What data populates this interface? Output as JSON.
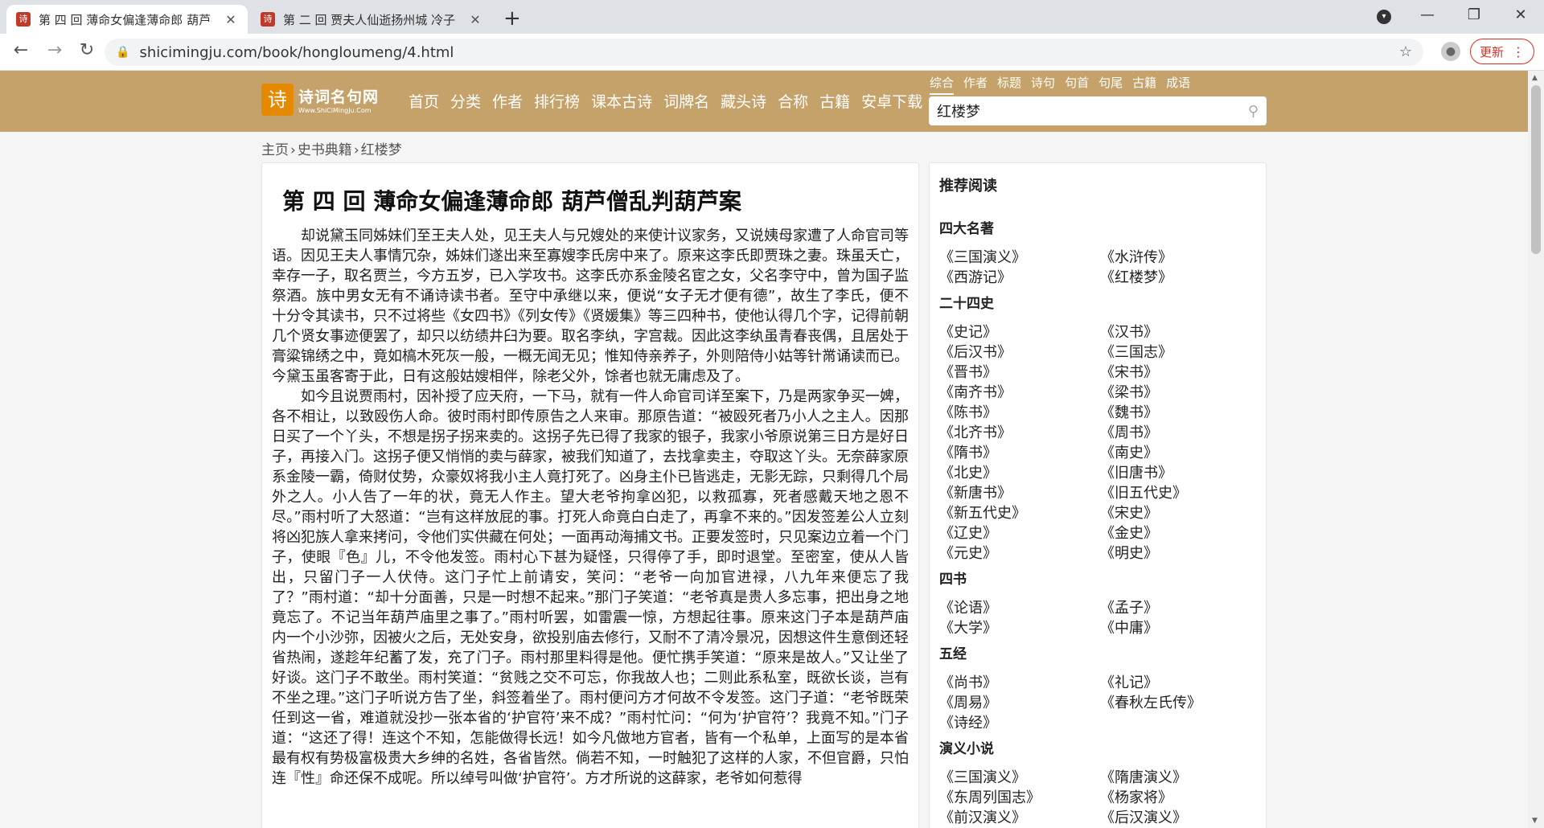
{
  "browser": {
    "tabs": [
      {
        "title": "第 四 回 薄命女偏逢薄命郎 葫芦",
        "favicon": "诗",
        "active": true
      },
      {
        "title": "第 二 回 贾夫人仙逝扬州城 冷子",
        "favicon": "诗",
        "active": false
      }
    ],
    "new_tab": "+",
    "url": "shicimingju.com/book/hongloumeng/4.html",
    "update_label": "更新",
    "icons": {
      "back": "←",
      "forward": "→",
      "reload": "↻",
      "lock": "🔒",
      "star": "☆",
      "close": "✕",
      "minimize": "—",
      "maximize": "❐",
      "menu": "⋮"
    }
  },
  "site": {
    "logo_text": "诗词名句网",
    "logo_sub": "Www.ShiCiMingJu.Com",
    "logo_mark": "诗",
    "nav": [
      "首页",
      "分类",
      "作者",
      "排行榜",
      "课本古诗",
      "词牌名",
      "藏头诗",
      "合称",
      "古籍",
      "安卓下载"
    ],
    "search_tabs": [
      "综合",
      "作者",
      "标题",
      "诗句",
      "句首",
      "句尾",
      "古籍",
      "成语"
    ],
    "search_value": "红楼梦"
  },
  "breadcrumb": [
    "主页",
    "史书典籍",
    "红楼梦"
  ],
  "breadcrumb_sep": "›",
  "chapter": {
    "title": "第 四 回 薄命女偏逢薄命郎 葫芦僧乱判葫芦案",
    "paragraphs": [
      "却说黛玉同姊妹们至王夫人处，见王夫人与兄嫂处的来使计议家务，又说姨母家遭了人命官司等语。因见王夫人事情冗杂，姊妹们遂出来至寡嫂李氏房中来了。原来这李氏即贾珠之妻。珠虽夭亡，幸存一子，取名贾兰，今方五岁，已入学攻书。这李氏亦系金陵名宦之女，父名李守中，曾为国子监祭酒。族中男女无有不诵诗读书者。至守中承继以来，便说“女子无才便有德”，故生了李氏，便不十分令其读书，只不过将些《女四书》《列女传》《贤媛集》等三四种书，使他认得几个字，记得前朝几个贤女事迹便罢了，却只以纺绩井臼为要。取名李纨，字宫裁。因此这李纨虽青春丧偶，且居处于膏粱锦绣之中，竟如槁木死灰一般，一概无闻无见；惟知侍亲养子，外则陪侍小姑等针黹诵读而已。今黛玉虽客寄于此，日有这般姑嫂相伴，除老父外，馀者也就无庸虑及了。",
      "如今且说贾雨村，因补授了应天府，一下马，就有一件人命官司详至案下，乃是两家争买一婢，各不相让，以致殴伤人命。彼时雨村即传原告之人来审。那原告道：“被殴死者乃小人之主人。因那日买了一个丫头，不想是拐子拐来卖的。这拐子先已得了我家的银子，我家小爷原说第三日方是好日子，再接入门。这拐子便又悄悄的卖与薛家，被我们知道了，去找拿卖主，夺取这丫头。无奈薛家原系金陵一霸，倚财仗势，众豪奴将我小主人竟打死了。凶身主仆已皆逃走，无影无踪，只剩得几个局外之人。小人告了一年的状，竟无人作主。望大老爷拘拿凶犯，以救孤寡，死者感戴天地之恩不尽。”雨村听了大怒道：“岂有这样放屁的事。打死人命竟白白走了，再拿不来的。”因发签差公人立刻将凶犯族人拿来拷问，令他们实供藏在何处；一面再动海捕文书。正要发签时，只见案边立着一个门子，使眼『色』儿，不令他发签。雨村心下甚为疑怪，只得停了手，即时退堂。至密室，使从人皆出，只留门子一人伏侍。这门子忙上前请安，笑问：“老爷一向加官进禄，八九年来便忘了我了？”雨村道：“却十分面善，只是一时想不起来。”那门子笑道：“老爷真是贵人多忘事，把出身之地竟忘了。不记当年葫芦庙里之事了。”雨村听罢，如雷震一惊，方想起往事。原来这门子本是葫芦庙内一个小沙弥，因被火之后，无处安身，欲投别庙去修行，又耐不了清冷景况，因想这件生意倒还轻省热闹，遂趁年纪蓄了发，充了门子。雨村那里料得是他。便忙携手笑道：“原来是故人。”又让坐了好谈。这门子不敢坐。雨村笑道：“贫贱之交不可忘，你我故人也；二则此系私室，既欲长谈，岂有不坐之理。”这门子听说方告了坐，斜签着坐了。雨村便问方才何故不令发签。这门子道：“老爷既荣任到这一省，难道就没抄一张本省的‘护官符’来不成？”雨村忙问：“何为‘护官符’？我竟不知。”门子道：“这还了得！连这个不知，怎能做得长远！如今凡做地方官者，皆有一个私单，上面写的是本省最有权有势极富极贵大乡绅的名姓，各省皆然。倘若不知，一时触犯了这样的人家，不但官爵，只怕连『性』命还保不成呢。所以绰号叫做‘护官符’。方才所说的这薛家，老爷如何惹得"
    ]
  },
  "sidebar": {
    "title": "推荐阅读",
    "sections": [
      {
        "heading": "四大名著",
        "items": [
          "《三国演义》",
          "《水浒传》",
          "《西游记》",
          "《红楼梦》"
        ]
      },
      {
        "heading": "二十四史",
        "items": [
          "《史记》",
          "《汉书》",
          "《后汉书》",
          "《三国志》",
          "《晋书》",
          "《宋书》",
          "《南齐书》",
          "《梁书》",
          "《陈书》",
          "《魏书》",
          "《北齐书》",
          "《周书》",
          "《隋书》",
          "《南史》",
          "《北史》",
          "《旧唐书》",
          "《新唐书》",
          "《旧五代史》",
          "《新五代史》",
          "《宋史》",
          "《辽史》",
          "《金史》",
          "《元史》",
          "《明史》"
        ]
      },
      {
        "heading": "四书",
        "items": [
          "《论语》",
          "《孟子》",
          "《大学》",
          "《中庸》"
        ]
      },
      {
        "heading": "五经",
        "items": [
          "《尚书》",
          "《礼记》",
          "《周易》",
          "《春秋左氏传》",
          "《诗经》"
        ]
      },
      {
        "heading": "演义小说",
        "items": [
          "《三国演义》",
          "《隋唐演义》",
          "《东周列国志》",
          "《杨家将》",
          "《前汉演义》",
          "《后汉演义》"
        ]
      }
    ]
  },
  "colors": {
    "header_bg": "#c5a26a",
    "update_red": "#d93025"
  }
}
